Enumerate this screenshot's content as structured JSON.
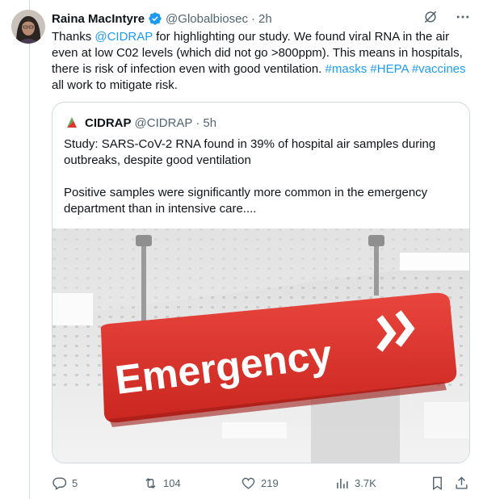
{
  "tweet": {
    "author_name": "Raina MacIntyre",
    "author_handle": "@Globalbiosec",
    "separator": "·",
    "time": "2h",
    "text_parts": [
      "Thanks ",
      "@CIDRAP",
      " for highlighting our study. We found viral RNA in the air even at low C02 levels (which did not go >800ppm). This means in hospitals, there is risk of infection even with good ventilation. ",
      "#masks",
      " ",
      "#HEPA",
      " ",
      "#vaccines",
      " all work to mitigate risk."
    ]
  },
  "quote": {
    "author_name": "CIDRAP",
    "author_handle": "@CIDRAP",
    "separator": "·",
    "time": "5h",
    "paragraph_1": "Study: SARS-CoV-2 RNA found in 39% of hospital air samples during outbreaks, despite good ventilation",
    "paragraph_2": "Positive samples were significantly more common in the emergency department than in intensive care....",
    "image_sign_text": "Emergency"
  },
  "actions": {
    "replies": "5",
    "retweets": "104",
    "likes": "219",
    "views": "3.7K"
  },
  "colors": {
    "accent": "#1d9bf0",
    "text": "#0f1419",
    "muted": "#536471",
    "border": "#cfd9de",
    "sign_red": "#d8312c"
  }
}
